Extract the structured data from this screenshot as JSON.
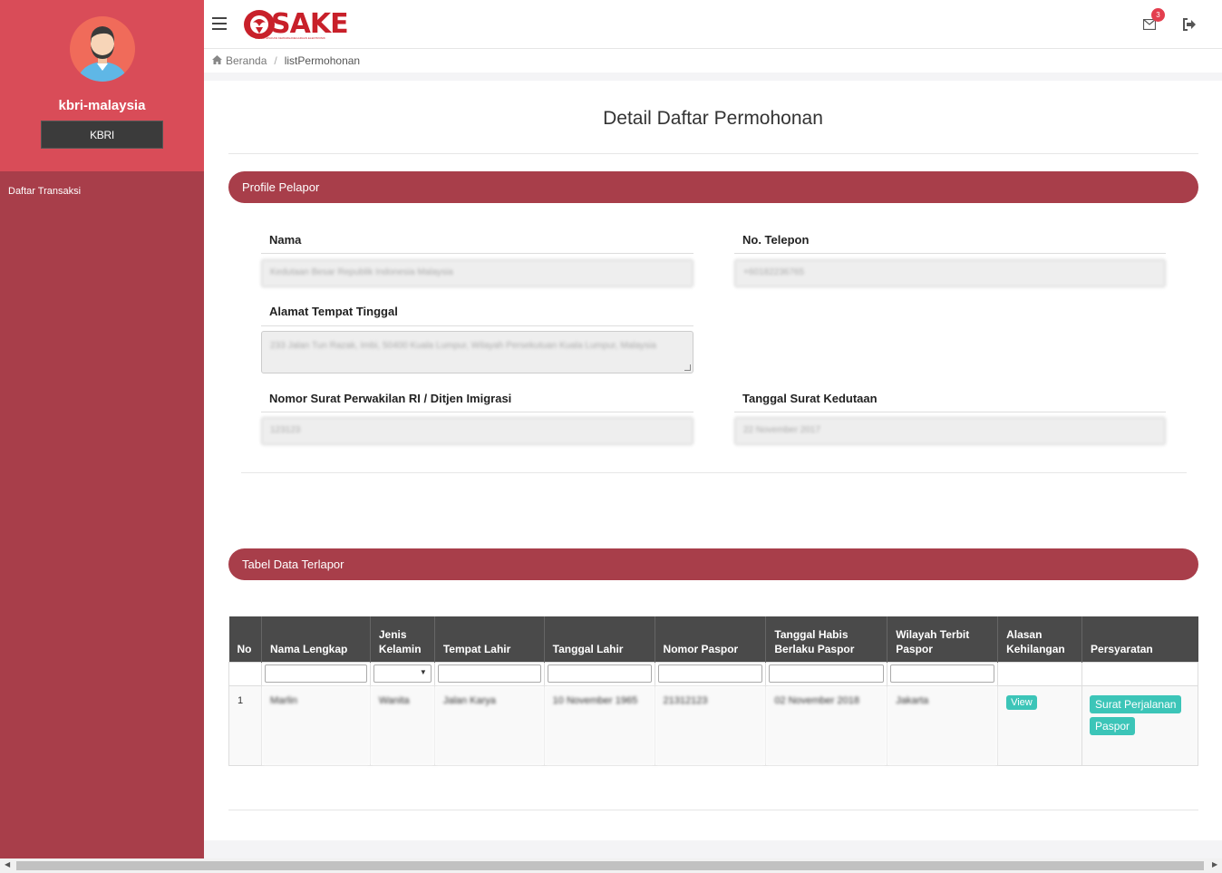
{
  "sidebar": {
    "username": "kbri-malaysia",
    "role": "KBRI",
    "menu": [
      "Daftar Transaksi"
    ]
  },
  "header": {
    "logo_text": "SAKE",
    "logo_sub": "SISTEM APLIKASI KEWARGANEGARAAN ELEKTRONIK",
    "mail_badge": "3"
  },
  "breadcrumb": {
    "home": "Beranda",
    "current": "listPermohonan"
  },
  "page": {
    "title": "Detail Daftar Permohonan"
  },
  "profile": {
    "section_title": "Profile Pelapor",
    "nama_label": "Nama",
    "nama_value": "Kedutaan Besar Republik Indonesia Malaysia",
    "telepon_label": "No. Telepon",
    "telepon_value": "+60182236765",
    "alamat_label": "Alamat Tempat Tinggal",
    "alamat_value": "233 Jalan Tun Razak, Imbi, 50400 Kuala Lumpur, Wilayah Persekutuan Kuala Lumpur, Malaysia",
    "nomor_surat_label": "Nomor Surat Perwakilan RI / Ditjen Imigrasi",
    "nomor_surat_value": "123123",
    "tanggal_surat_label": "Tanggal Surat Kedutaan",
    "tanggal_surat_value": "22 November 2017"
  },
  "table": {
    "section_title": "Tabel Data Terlapor",
    "columns": [
      "No",
      "Nama Lengkap",
      "Jenis Kelamin",
      "Tempat Lahir",
      "Tanggal Lahir",
      "Nomor Paspor",
      "Tanggal Habis Berlaku Paspor",
      "Wilayah Terbit Paspor",
      "Alasan Kehilangan",
      "Persyaratan"
    ],
    "rows": [
      {
        "no": "1",
        "nama": "Marlin",
        "jenis_kelamin": "Wanita",
        "tempat_lahir": "Jalan Karya",
        "tanggal_lahir": "10 November 1965",
        "nomor_paspor": "21312123",
        "tanggal_habis": "02 November 2018",
        "wilayah_terbit": "Jakarta",
        "alasan_btn": "View",
        "persyaratan_btns": [
          "Surat Perjalanan",
          "Paspor"
        ]
      }
    ]
  },
  "colors": {
    "sidebar": "#a83e4a",
    "sidebar_top": "#d94c58",
    "section_header": "#a83e4a",
    "table_header": "#4a4a4a",
    "button_teal": "#3cc5b8",
    "badge": "#e33e4e"
  },
  "icons": [
    "hamburger-icon",
    "envelope-icon",
    "sign-out-icon",
    "home-icon",
    "avatar-icon"
  ]
}
